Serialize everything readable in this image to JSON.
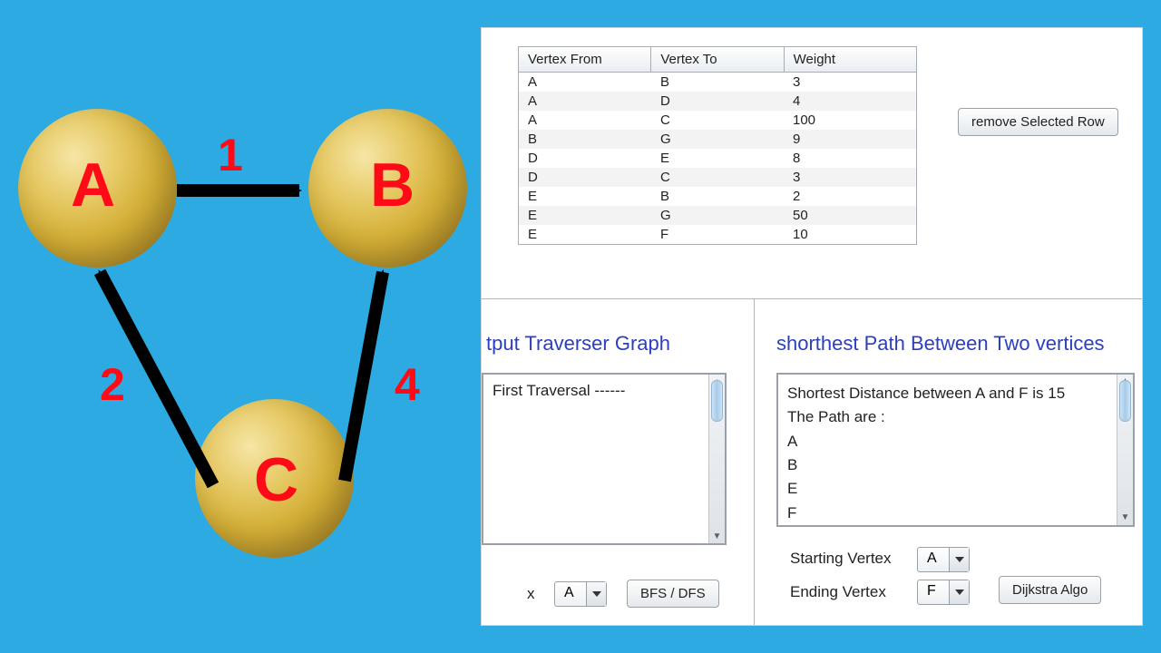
{
  "graph": {
    "nodeA": "A",
    "nodeB": "B",
    "nodeC": "C",
    "edgeAB": "1",
    "edgeCA": "2",
    "edgeCB": "4"
  },
  "table": {
    "headers": {
      "from": "Vertex From",
      "to": "Vertex To",
      "weight": "Weight"
    },
    "rows": [
      {
        "from": "A",
        "to": "B",
        "weight": "3"
      },
      {
        "from": "A",
        "to": "D",
        "weight": "4"
      },
      {
        "from": "A",
        "to": "C",
        "weight": "100"
      },
      {
        "from": "B",
        "to": "G",
        "weight": "9"
      },
      {
        "from": "D",
        "to": "E",
        "weight": "8"
      },
      {
        "from": "D",
        "to": "C",
        "weight": "3"
      },
      {
        "from": "E",
        "to": "B",
        "weight": "2"
      },
      {
        "from": "E",
        "to": "G",
        "weight": "50"
      },
      {
        "from": "E",
        "to": "F",
        "weight": "10"
      }
    ]
  },
  "buttons": {
    "removeRow": "remove Selected Row",
    "bfsDfs": "BFS / DFS",
    "dijkstra": "Dijkstra Algo"
  },
  "traverser": {
    "title": "tput Traverser Graph",
    "output": "First Traversal ------",
    "xLabel": "x",
    "selected": "A"
  },
  "shortest": {
    "title": "shorthest Path Between Two vertices",
    "lines": [
      "Shortest Distance between A and F is 15",
      " The Path are :",
      "A",
      "B",
      "E",
      "F"
    ],
    "startLabel": "Starting Vertex",
    "endLabel": "Ending Vertex",
    "startValue": "A",
    "endValue": "F"
  }
}
